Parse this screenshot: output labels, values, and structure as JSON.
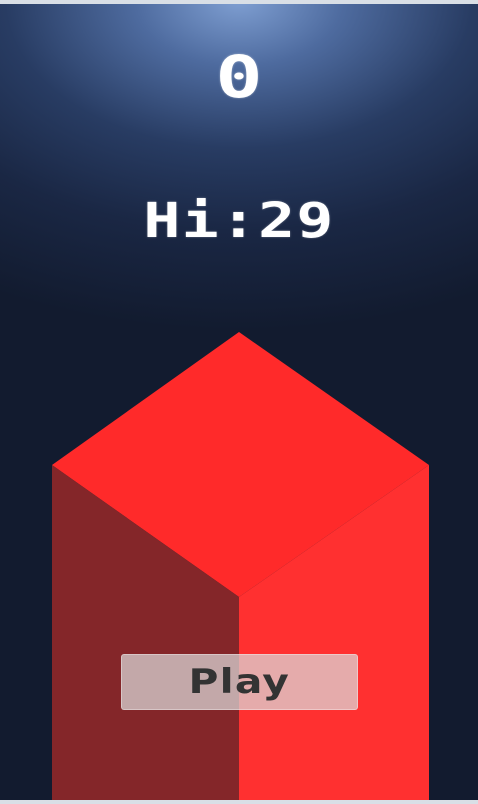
{
  "game": {
    "current_score": "0",
    "high_score": "Hi:29",
    "play_label": "Play"
  },
  "colors": {
    "top_face": "#ff2a2a",
    "left_face": "#842629",
    "right_face": "#ff3030",
    "background_top": "#7f9fd2",
    "background_bottom": "#121b2f",
    "button_fill": "#dbdbdb",
    "button_text": "#333333"
  },
  "icons": {
    "block": "red-isometric-block"
  }
}
